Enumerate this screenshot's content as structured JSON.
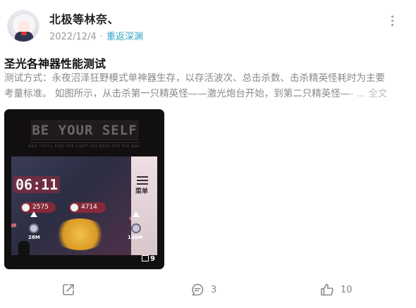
{
  "post": {
    "author": "北极等林奈、",
    "date": "2022/12/4",
    "separator": "·",
    "source": "重返深渊",
    "title": "圣光各神器性能测试",
    "excerpt_line1": "测试方式：永夜沼泽狂野模式单神器生存，以存活波次、总击杀数、击杀精英怪耗时为主要",
    "excerpt_line2": "考量标准。 如图所示，从击杀第一只精英怪——激光炮台开始，到第二只精英怪—",
    "excerpt_fade": "-",
    "excerpt_ellipsis": "...",
    "full_text_link": "全文"
  },
  "media": {
    "banner_text": "BE YOUR SELF",
    "banner_sub": "AND YOU'LL FIND THE LIGHT YOU NEED FOR THE WAY",
    "timer": "06:11",
    "kills": "2575",
    "elite": "4714",
    "menu_label": "菜单",
    "unit_left": "28M",
    "unit_right": "140M",
    "image_count": "9"
  },
  "actions": {
    "comments": "3",
    "likes": "10"
  },
  "icons": {
    "share": "share-icon",
    "comment": "comment-icon",
    "like": "thumbs-up-icon",
    "more": "more-vertical-icon",
    "gallery": "image-stack-icon"
  },
  "colors": {
    "source_link": "#2fa6c8",
    "muted_text": "#999999"
  }
}
